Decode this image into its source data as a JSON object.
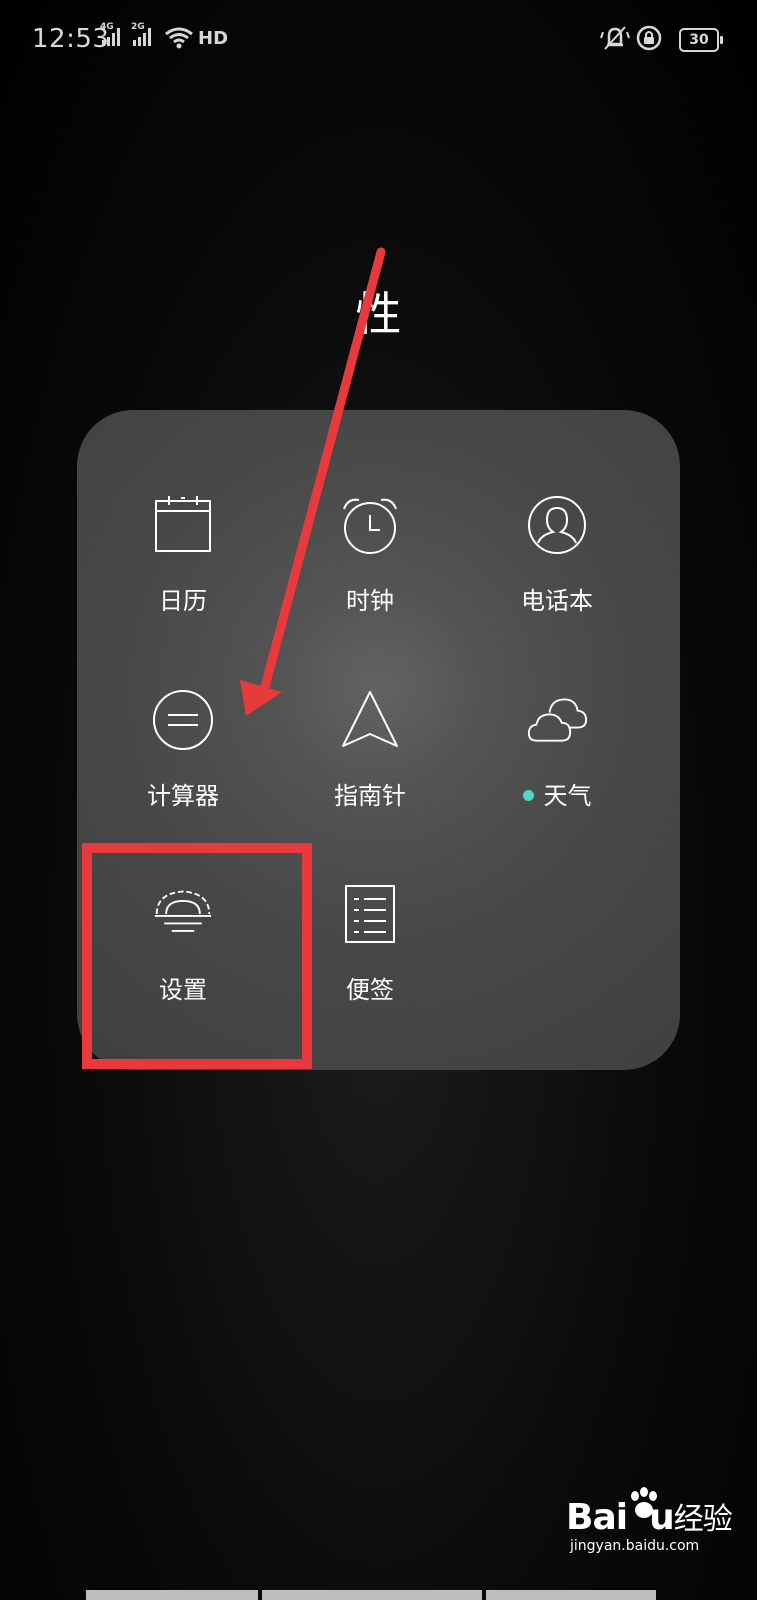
{
  "status_bar": {
    "time": "12:53",
    "signal_1_tag": "4G",
    "signal_2_tag": "2G",
    "hd_label": "HD",
    "battery": "30",
    "icons": [
      "signal-icon",
      "signal-icon",
      "wifi-icon",
      "vibrate-icon",
      "rotation-lock-icon",
      "battery-icon"
    ]
  },
  "folder": {
    "title": "性",
    "apps": [
      {
        "label": "日历",
        "icon": "calendar-icon"
      },
      {
        "label": "时钟",
        "icon": "alarm-clock-icon"
      },
      {
        "label": "电话本",
        "icon": "contacts-icon"
      },
      {
        "label": "计算器",
        "icon": "calculator-icon"
      },
      {
        "label": "指南针",
        "icon": "compass-icon"
      },
      {
        "label": "天气",
        "icon": "weather-cloud-icon",
        "new_dot_color": "#4fd6c8"
      },
      {
        "label": "设置",
        "icon": "settings-icon"
      },
      {
        "label": "便签",
        "icon": "notes-icon"
      }
    ]
  },
  "annotation": {
    "color": "#e8393c",
    "arrow_target": "设置",
    "box_target": "设置"
  },
  "watermark": {
    "brand": "Bai",
    "brand_tail": "u",
    "product": "经验",
    "url": "jingyan.baidu.com"
  }
}
